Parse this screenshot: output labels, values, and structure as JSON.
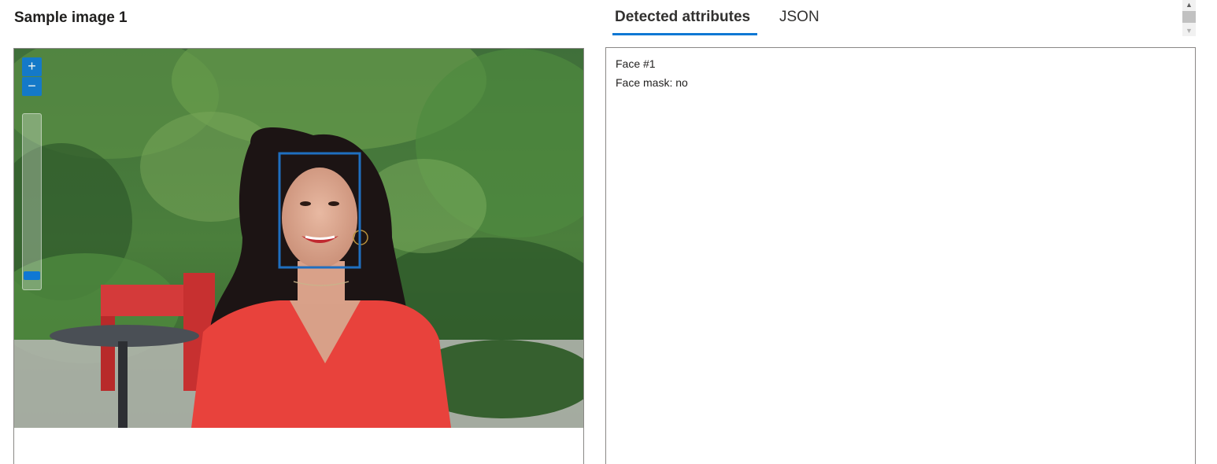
{
  "sample": {
    "title": "Sample image 1"
  },
  "viewer": {
    "zoom_in_label": "+",
    "zoom_out_label": "−",
    "zoom_level": 0.05
  },
  "tabs": [
    {
      "label": "Detected attributes",
      "selected": true
    },
    {
      "label": "JSON",
      "selected": false
    }
  ],
  "results": {
    "lines": [
      "Face #1",
      "Face mask: no"
    ]
  },
  "colors": {
    "accent": "#0f78d4",
    "face_box": "#1f6fc0",
    "border": "#8a8886"
  },
  "icons": {
    "scroll_up": "chevron-up-icon",
    "scroll_down": "chevron-down-icon"
  }
}
